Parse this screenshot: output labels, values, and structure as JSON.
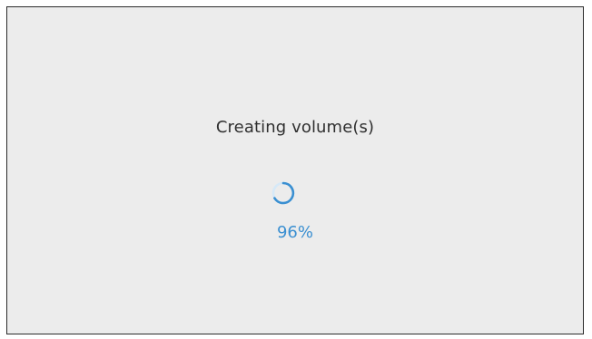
{
  "dialog": {
    "title": "Creating volume(s)",
    "progress_text": "96%",
    "progress_value": 0.96
  },
  "icons": {
    "spinner": "loading-spinner-icon"
  },
  "colors": {
    "background": "#ececec",
    "title": "#2f2f2f",
    "accent": "#3a8fd1",
    "border": "#2b2b2b"
  }
}
